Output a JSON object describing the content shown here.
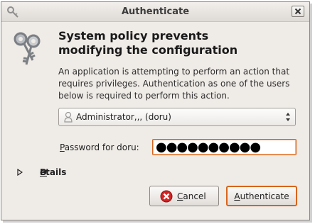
{
  "window": {
    "title": "Authenticate",
    "close_icon": "close-icon"
  },
  "dialog": {
    "heading_line1": "System policy prevents",
    "heading_line2": "modifying the configuration",
    "description": "An application is attempting to perform an action that requires privileges. Authentication as one of the users below is required to perform this action.",
    "user_select": {
      "selected": "Administrator,,, (doru)",
      "icon": "user-icon"
    },
    "password": {
      "label_mnemonic": "P",
      "label_rest": "assword for doru:",
      "masked_value": "●●●●●●●●●●"
    },
    "details": {
      "mnemonic": "D",
      "rest": "etails"
    },
    "buttons": {
      "cancel_mnemonic": "C",
      "cancel_rest": "ancel",
      "auth_mnemonic": "A",
      "auth_rest": "uthenticate"
    }
  },
  "colors": {
    "focus": "#d8641b",
    "window_bg": "#efebe7"
  }
}
